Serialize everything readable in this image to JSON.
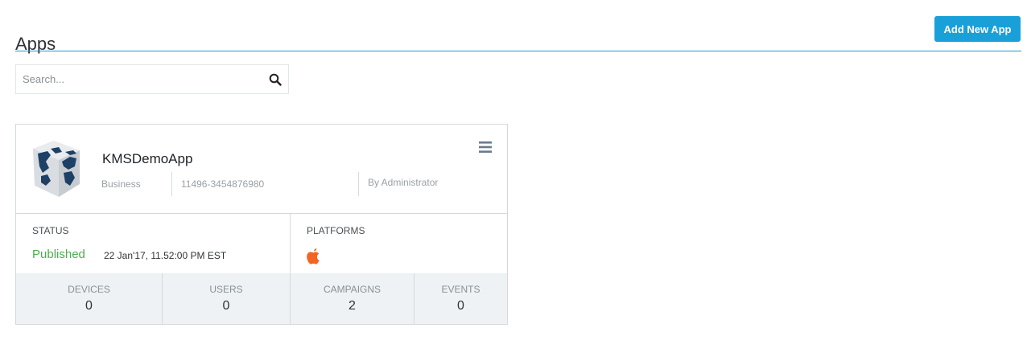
{
  "header": {
    "title": "Apps",
    "add_button_label": "Add New App"
  },
  "search": {
    "placeholder": "Search...",
    "value": ""
  },
  "app_card": {
    "name": "KMSDemoApp",
    "category": "Business",
    "app_id": "11496-3454876980",
    "created_by": "By Administrator",
    "status_label": "STATUS",
    "status_value": "Published",
    "status_date": "22 Jan'17, 11.52:00 PM EST",
    "platforms_label": "PLATFORMS",
    "platforms": [
      "apple-icon"
    ],
    "stats": [
      {
        "label": "DEVICES",
        "value": "0"
      },
      {
        "label": "USERS",
        "value": "0"
      },
      {
        "label": "CAMPAIGNS",
        "value": "2"
      },
      {
        "label": "EVENTS",
        "value": "0"
      }
    ]
  },
  "colors": {
    "accent": "#1aa0d8",
    "published": "#4cae4c",
    "apple_icon": "#f26522",
    "stats_background": "#eef2f4"
  }
}
